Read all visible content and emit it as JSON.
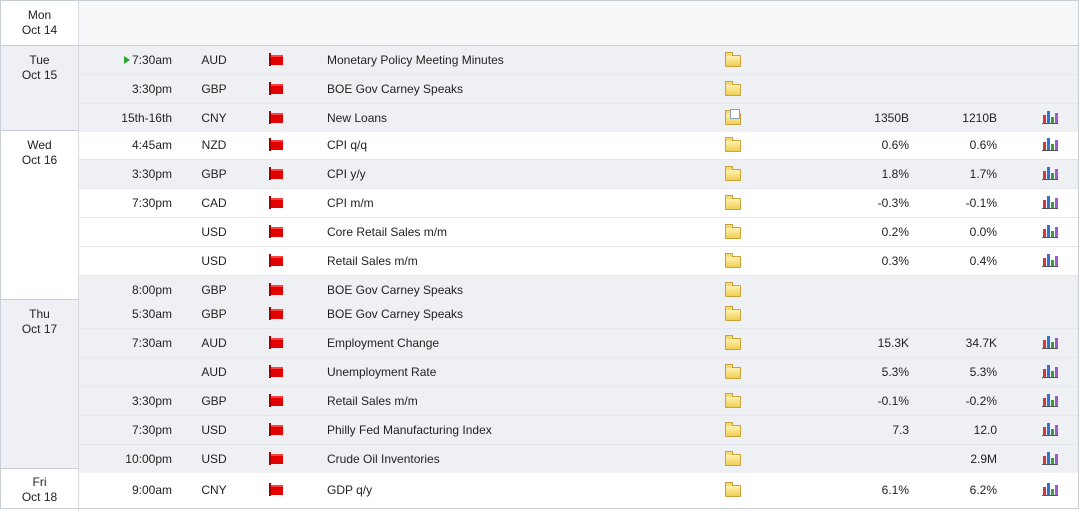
{
  "colors": {
    "impact_high": "#e00000",
    "grid_border": "#c9ced6",
    "row_alt": "#eef0f3",
    "playing_marker": "#2ea52e"
  },
  "days": [
    {
      "weekday": "Mon",
      "date": "Oct 14",
      "rows": []
    },
    {
      "weekday": "Tue",
      "date": "Oct 15",
      "rows": [
        {
          "time": "7:30am",
          "playing": true,
          "currency": "AUD",
          "event": "Monetary Policy Meeting Minutes",
          "detail_icon": "folder-icon",
          "forecast": "",
          "previous": "",
          "has_chart": false
        },
        {
          "time": "3:30pm",
          "currency": "GBP",
          "event": "BOE Gov Carney Speaks",
          "detail_icon": "folder-icon",
          "forecast": "",
          "previous": "",
          "has_chart": false
        },
        {
          "time": "15th-16th",
          "currency": "CNY",
          "event": "New Loans",
          "detail_icon": "folder-note-icon",
          "forecast": "1350B",
          "previous": "1210B",
          "has_chart": true
        }
      ]
    },
    {
      "weekday": "Wed",
      "date": "Oct 16",
      "rows": [
        {
          "time": "4:45am",
          "currency": "NZD",
          "event": "CPI q/q",
          "detail_icon": "folder-icon",
          "forecast": "0.6%",
          "previous": "0.6%",
          "has_chart": true
        },
        {
          "time": "3:30pm",
          "currency": "GBP",
          "event": "CPI y/y",
          "detail_icon": "folder-icon",
          "forecast": "1.8%",
          "previous": "1.7%",
          "has_chart": true
        },
        {
          "time": "7:30pm",
          "currency": "CAD",
          "event": "CPI m/m",
          "detail_icon": "folder-icon",
          "forecast": "-0.3%",
          "previous": "-0.1%",
          "has_chart": true
        },
        {
          "time": "",
          "currency": "USD",
          "event": "Core Retail Sales m/m",
          "detail_icon": "folder-icon",
          "forecast": "0.2%",
          "previous": "0.0%",
          "has_chart": true
        },
        {
          "time": "",
          "currency": "USD",
          "event": "Retail Sales m/m",
          "detail_icon": "folder-icon",
          "forecast": "0.3%",
          "previous": "0.4%",
          "has_chart": true
        },
        {
          "time": "8:00pm",
          "currency": "GBP",
          "event": "BOE Gov Carney Speaks",
          "detail_icon": "folder-icon",
          "forecast": "",
          "previous": "",
          "has_chart": false
        }
      ]
    },
    {
      "weekday": "Thu",
      "date": "Oct 17",
      "rows": [
        {
          "time": "5:30am",
          "currency": "GBP",
          "event": "BOE Gov Carney Speaks",
          "detail_icon": "folder-icon",
          "forecast": "",
          "previous": "",
          "has_chart": false
        },
        {
          "time": "7:30am",
          "currency": "AUD",
          "event": "Employment Change",
          "detail_icon": "folder-icon",
          "forecast": "15.3K",
          "previous": "34.7K",
          "has_chart": true
        },
        {
          "time": "",
          "currency": "AUD",
          "event": "Unemployment Rate",
          "detail_icon": "folder-icon",
          "forecast": "5.3%",
          "previous": "5.3%",
          "has_chart": true
        },
        {
          "time": "3:30pm",
          "currency": "GBP",
          "event": "Retail Sales m/m",
          "detail_icon": "folder-icon",
          "forecast": "-0.1%",
          "previous": "-0.2%",
          "has_chart": true
        },
        {
          "time": "7:30pm",
          "currency": "USD",
          "event": "Philly Fed Manufacturing Index",
          "detail_icon": "folder-icon",
          "forecast": "7.3",
          "previous": "12.0",
          "has_chart": true
        },
        {
          "time": "10:00pm",
          "currency": "USD",
          "event": "Crude Oil Inventories",
          "detail_icon": "folder-icon",
          "forecast": "",
          "previous": "2.9M",
          "has_chart": true
        }
      ]
    },
    {
      "weekday": "Fri",
      "date": "Oct 18",
      "rows": [
        {
          "time": "9:00am",
          "currency": "CNY",
          "event": "GDP q/y",
          "detail_icon": "folder-icon",
          "forecast": "6.1%",
          "previous": "6.2%",
          "has_chart": true
        }
      ]
    }
  ]
}
